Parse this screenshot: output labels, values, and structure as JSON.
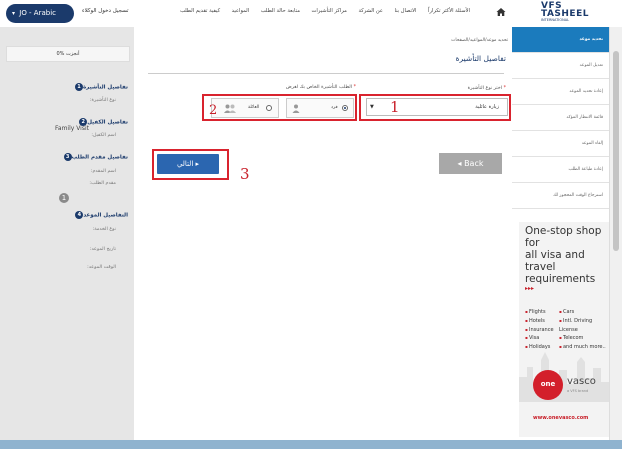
{
  "header": {
    "lang_button": "JO - Arabic",
    "login_link": "تسجيل دخول الوكلاء",
    "nav": [
      "كيفية تقديم الطلب",
      "المواعيد",
      "متابعة حالة الطلب",
      "مراكز التأشيرات",
      "عن الشركة",
      "الاتصال بنا",
      "الأسئلة الأكثر تكراراً"
    ],
    "logo_line1": "VFS",
    "logo_line2": "TASHEEL",
    "logo_line3": "INTERNATIONAL"
  },
  "left_panel": {
    "progress": "0% أنجزت",
    "sections": [
      {
        "num": "1",
        "title": "تفاصيل التأشيرة",
        "sub": "نوع التأشيرة:",
        "value": "Family Visit"
      },
      {
        "num": "2",
        "title": "تفاصيل الكفيل",
        "sub": "اسم الكفيل:"
      },
      {
        "num": "3",
        "title": "تفاصيل مقدم الطلب",
        "subs": [
          "اسم المقدم:",
          "مقدم الطلب:"
        ],
        "count": "1"
      },
      {
        "num": "4",
        "title": "التفاصيل الموعد",
        "subs": [
          "نوع الخدمة:",
          "تاريخ الموعد:",
          "الوقت الموعد:"
        ]
      }
    ]
  },
  "main": {
    "breadcrumb": "تحديد موعد/المواعيد/الصفحات",
    "title": "تفاصيل التأشيرة",
    "visa_type_label": "اختر نوع التأشيرة",
    "required_mark": "*",
    "applicant_label": "الطلب التأشيرة الخاص بك لغرض",
    "visa_type_value": "زيارة عائلية",
    "option_individual": "فرد",
    "option_family": "العائلة",
    "back_label": "Back",
    "next_label": "التالي",
    "annotations": [
      "1",
      "2",
      "3"
    ]
  },
  "right_menu": {
    "items": [
      "تحديد موعد",
      "تعديل الموعد",
      "إعادة تحديد الموعد",
      "قائمة الانتظار المؤكد",
      "إلغاء الموعد",
      "إعادة طباعة الطلب",
      "استرجاع الوقت المحجوز لك"
    ]
  },
  "ad": {
    "headline": [
      "One-stop shop for",
      "all visa and",
      "travel requirements"
    ],
    "arrows": "▸▸▸",
    "left_col": [
      "Flights",
      "Hotels",
      "Insurance",
      "Visa",
      "Holidays"
    ],
    "right_col": [
      "Cars",
      "Intl. Driving License",
      "Telecom",
      "and much more.."
    ],
    "brand": "one",
    "brand2": "vasco",
    "brand3": "a VFS brand",
    "url": "www.onevasco.com"
  },
  "colors": {
    "navy": "#1b3a6b",
    "accent_blue": "#1b7bbd",
    "button_blue": "#2b66b0",
    "annotation_red": "#d9232e"
  }
}
